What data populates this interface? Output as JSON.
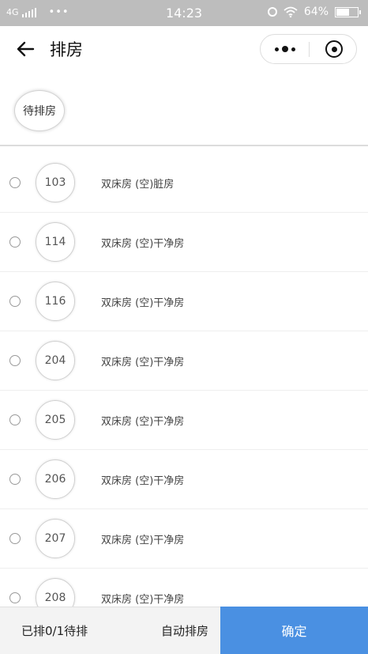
{
  "status_bar": {
    "network": "4G",
    "dots": "•••",
    "time": "14:23",
    "battery": "64%",
    "battery_level": 0.64
  },
  "nav": {
    "title": "排房"
  },
  "filter": {
    "chip_label": "待排房"
  },
  "rooms": [
    {
      "number": "103",
      "desc": "双床房 (空)脏房"
    },
    {
      "number": "114",
      "desc": "双床房 (空)干净房"
    },
    {
      "number": "116",
      "desc": "双床房 (空)干净房"
    },
    {
      "number": "204",
      "desc": "双床房 (空)干净房"
    },
    {
      "number": "205",
      "desc": "双床房 (空)干净房"
    },
    {
      "number": "206",
      "desc": "双床房 (空)干净房"
    },
    {
      "number": "207",
      "desc": "双床房 (空)干净房"
    },
    {
      "number": "208",
      "desc": "双床房 (空)干净房"
    }
  ],
  "bottom": {
    "status_text": "已排0/1待排",
    "auto_label": "自动排房",
    "confirm_label": "确定"
  },
  "colors": {
    "accent": "#4a90e2",
    "status_bar": "#bdbdbd"
  }
}
